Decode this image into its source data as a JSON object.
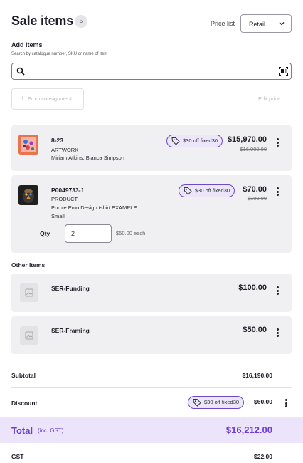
{
  "header": {
    "title": "Sale items",
    "count": "5",
    "price_list_label": "Price list",
    "price_list_value": "Retail"
  },
  "add_items": {
    "label": "Add items",
    "help": "Search by catalogue number, SKU or name of item",
    "search_value": "",
    "search_placeholder": ""
  },
  "actions": {
    "from_consignment": "From consignment",
    "edit_price": "Edit price"
  },
  "items": [
    {
      "code": "8-23",
      "type": "ARTWORK",
      "detail": "Miriam Atkins, Bianca Simpson",
      "discount_tag": "$30 off fixed30",
      "price": "$15,970.00",
      "old_price": "$16,000.00"
    },
    {
      "code": "P0049733-1",
      "type": "PRODUCT",
      "detail": "Purple Emu Design tshirt EXAMPLE",
      "detail2": "Small",
      "discount_tag": "$30 off fixed30",
      "price": "$70.00",
      "old_price": "$100.00",
      "qty_label": "Qty",
      "qty_value": "2",
      "each": "$50.00 each"
    }
  ],
  "other_items": {
    "label": "Other Items",
    "rows": [
      {
        "name": "SER-Funding",
        "price": "$100.00"
      },
      {
        "name": "SER-Framing",
        "price": "$50.00"
      }
    ]
  },
  "summary": {
    "subtotal_label": "Subtotal",
    "subtotal_value": "$16,190.00",
    "discount_label": "Discount",
    "discount_tag": "$30 off fixed30",
    "discount_value": "$60.00",
    "total_label": "Total",
    "total_sub": "(inc. GST)",
    "total_value": "$16,212.00",
    "gst_label": "GST",
    "gst_value": "$22.00"
  },
  "colors": {
    "accent": "#6d3fd1",
    "tag_border": "#6f48c7",
    "card_bg": "#f0f0f3",
    "total_band": "#ebe4fb"
  },
  "icons": [
    "search-icon",
    "barcode-scan-icon",
    "chevron-down-icon",
    "tag-icon",
    "more-vertical-icon",
    "image-placeholder-icon",
    "plus-icon"
  ]
}
